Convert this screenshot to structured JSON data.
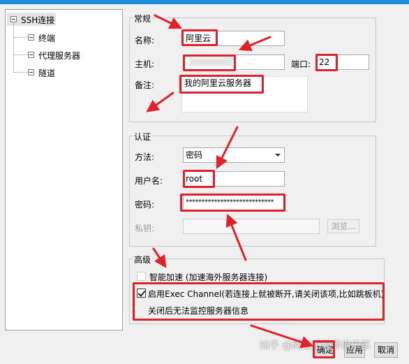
{
  "tree": {
    "root": "SSH连接",
    "children": [
      "终端",
      "代理服务器",
      "隧道"
    ]
  },
  "general": {
    "title": "常规",
    "name_label": "名称:",
    "name_value": "阿里云",
    "host_label": "主机:",
    "host_value": "",
    "port_label": "端口:",
    "port_value": "22",
    "note_label": "备注:",
    "note_value": "我的阿里云服务器"
  },
  "auth": {
    "title": "认证",
    "method_label": "方法:",
    "method_value": "密码",
    "user_label": "用户名:",
    "user_value": "root",
    "password_label": "密码:",
    "password_value": "****************************",
    "key_label": "私钥:",
    "browse_label": "浏览..."
  },
  "advanced": {
    "title": "高级",
    "accel_label": "智能加速 (加速海外服务器连接)",
    "accel_checked": false,
    "exec_label": "启用Exec Channel(若连接上就被断开,请关闭该项,比如跳板机)",
    "exec_checked": true,
    "exec_note": "关闭后无法监控服务器信息"
  },
  "buttons": {
    "ok": "确定",
    "apply": "应用",
    "cancel": "取消"
  },
  "watermark": "知乎 @网络工程师俱乐部",
  "colors": {
    "highlight": "#e0202a",
    "accent_bar": "#1c8ed8"
  }
}
